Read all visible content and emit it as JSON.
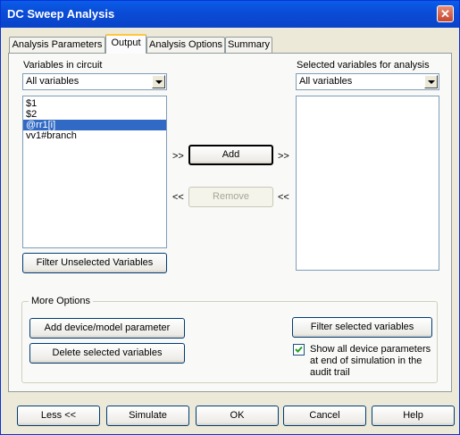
{
  "window": {
    "title": "DC Sweep Analysis",
    "close_icon": "close-icon"
  },
  "tabs": [
    {
      "label": "Analysis Parameters",
      "active": false
    },
    {
      "label": "Output",
      "active": true
    },
    {
      "label": "Analysis Options",
      "active": false
    },
    {
      "label": "Summary",
      "active": false
    }
  ],
  "left": {
    "heading": "Variables in circuit",
    "filter_value": "All variables",
    "variables": [
      "$1",
      "$2",
      "@rr1[i]",
      "vv1#branch"
    ],
    "selected_index": 2,
    "filter_button": "Filter Unselected Variables"
  },
  "middle": {
    "add_label": "Add",
    "remove_label": "Remove",
    "arrow_right": ">>",
    "arrow_left": "<<"
  },
  "right": {
    "heading": "Selected variables for analysis",
    "filter_value": "All variables"
  },
  "more_options": {
    "title": "More Options",
    "add_param_button": "Add device/model parameter",
    "delete_button": "Delete selected variables",
    "filter_selected_button": "Filter selected variables",
    "show_params_checkbox": {
      "checked": true,
      "line1": "Show all device parameters",
      "line2": "at end of simulation in the",
      "line3": "audit trail"
    }
  },
  "bottom": {
    "less_button": "Less <<",
    "simulate_button": "Simulate",
    "ok_button": "OK",
    "cancel_button": "Cancel",
    "help_button": "Help"
  },
  "colors": {
    "titlebar": "#0a5de8",
    "selection": "#316ac5",
    "tab_highlight": "#ffc83c"
  }
}
